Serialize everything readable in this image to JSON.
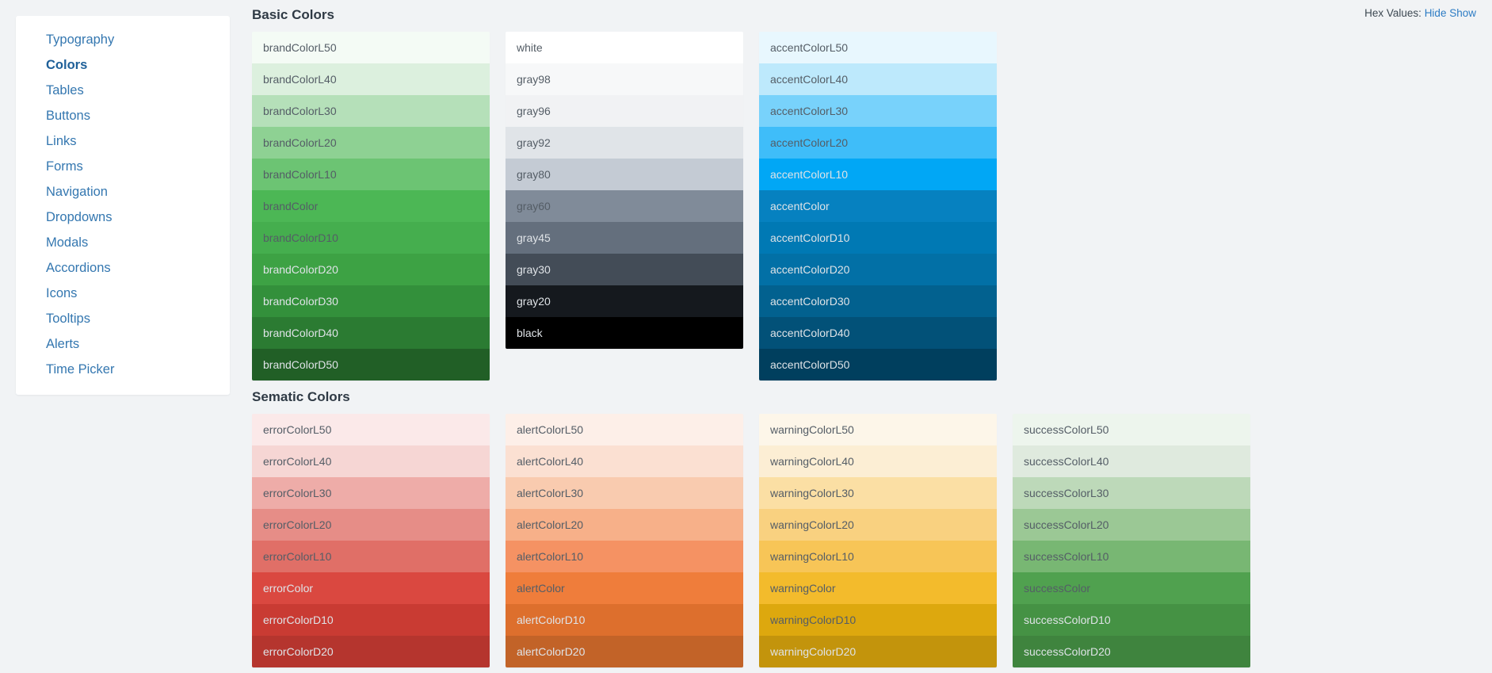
{
  "sidebar": {
    "items": [
      {
        "label": "Typography",
        "active": false
      },
      {
        "label": "Colors",
        "active": true
      },
      {
        "label": "Tables",
        "active": false
      },
      {
        "label": "Buttons",
        "active": false
      },
      {
        "label": "Links",
        "active": false
      },
      {
        "label": "Forms",
        "active": false
      },
      {
        "label": "Navigation",
        "active": false
      },
      {
        "label": "Dropdowns",
        "active": false
      },
      {
        "label": "Modals",
        "active": false
      },
      {
        "label": "Accordions",
        "active": false
      },
      {
        "label": "Icons",
        "active": false
      },
      {
        "label": "Tooltips",
        "active": false
      },
      {
        "label": "Alerts",
        "active": false
      },
      {
        "label": "Time Picker",
        "active": false
      }
    ]
  },
  "hex_toggle": {
    "label": "Hex Values:",
    "hide_label": "Hide",
    "show_label": "Show"
  },
  "sections": [
    {
      "title": "Basic Colors",
      "columns": [
        {
          "name": "brand",
          "swatches": [
            {
              "label": "brandColorL50",
              "hex": "#f4fbf5",
              "text": "dark"
            },
            {
              "label": "brandColorL40",
              "hex": "#dcf0de",
              "text": "dark"
            },
            {
              "label": "brandColorL30",
              "hex": "#b5e0b9",
              "text": "dark"
            },
            {
              "label": "brandColorL20",
              "hex": "#8ed193",
              "text": "dark"
            },
            {
              "label": "brandColorL10",
              "hex": "#6cc473",
              "text": "dark"
            },
            {
              "label": "brandColor",
              "hex": "#4cb755",
              "text": "dark"
            },
            {
              "label": "brandColorD10",
              "hex": "#45ae4e",
              "text": "dark"
            },
            {
              "label": "brandColorD20",
              "hex": "#3da244",
              "text": "light"
            },
            {
              "label": "brandColorD30",
              "hex": "#33903b",
              "text": "light"
            },
            {
              "label": "brandColorD40",
              "hex": "#2b7b32",
              "text": "light"
            },
            {
              "label": "brandColorD50",
              "hex": "#215f26",
              "text": "light"
            }
          ]
        },
        {
          "name": "gray",
          "swatches": [
            {
              "label": "white",
              "hex": "#ffffff",
              "text": "dark"
            },
            {
              "label": "gray98",
              "hex": "#f7f8f9",
              "text": "dark"
            },
            {
              "label": "gray96",
              "hex": "#f1f2f4",
              "text": "dark"
            },
            {
              "label": "gray92",
              "hex": "#e0e4e8",
              "text": "dark"
            },
            {
              "label": "gray80",
              "hex": "#c4cbd4",
              "text": "dark"
            },
            {
              "label": "gray60",
              "hex": "#808b99",
              "text": "dark"
            },
            {
              "label": "gray45",
              "hex": "#646f7d",
              "text": "light"
            },
            {
              "label": "gray30",
              "hex": "#434c57",
              "text": "light"
            },
            {
              "label": "gray20",
              "hex": "#15191e",
              "text": "light"
            },
            {
              "label": "black",
              "hex": "#000000",
              "text": "light"
            }
          ]
        },
        {
          "name": "accent",
          "swatches": [
            {
              "label": "accentColorL50",
              "hex": "#e8f7fe",
              "text": "dark"
            },
            {
              "label": "accentColorL40",
              "hex": "#bde9fc",
              "text": "dark"
            },
            {
              "label": "accentColorL30",
              "hex": "#78d2fb",
              "text": "dark"
            },
            {
              "label": "accentColorL20",
              "hex": "#3fbdf9",
              "text": "dark"
            },
            {
              "label": "accentColorL10",
              "hex": "#01a7f5",
              "text": "light"
            },
            {
              "label": "accentColor",
              "hex": "#0681c0",
              "text": "light"
            },
            {
              "label": "accentColorD10",
              "hex": "#0079b4",
              "text": "light"
            },
            {
              "label": "accentColorD20",
              "hex": "#0270a6",
              "text": "light"
            },
            {
              "label": "accentColorD30",
              "hex": "#02618f",
              "text": "light"
            },
            {
              "label": "accentColorD40",
              "hex": "#025178",
              "text": "light"
            },
            {
              "label": "accentColorD50",
              "hex": "#003f5e",
              "text": "light"
            }
          ]
        }
      ]
    },
    {
      "title": "Sematic Colors",
      "columns": [
        {
          "name": "error",
          "swatches": [
            {
              "label": "errorColorL50",
              "hex": "#fbe9e9",
              "text": "dark"
            },
            {
              "label": "errorColorL40",
              "hex": "#f6d6d4",
              "text": "dark"
            },
            {
              "label": "errorColorL30",
              "hex": "#eeaca8",
              "text": "dark"
            },
            {
              "label": "errorColorL20",
              "hex": "#e68d87",
              "text": "dark"
            },
            {
              "label": "errorColorL10",
              "hex": "#e06f67",
              "text": "dark"
            },
            {
              "label": "errorColor",
              "hex": "#da4840",
              "text": "light"
            },
            {
              "label": "errorColorD10",
              "hex": "#c93b33",
              "text": "light"
            },
            {
              "label": "errorColorD20",
              "hex": "#b5352e",
              "text": "light"
            }
          ]
        },
        {
          "name": "alert",
          "swatches": [
            {
              "label": "alertColorL50",
              "hex": "#fdefe8",
              "text": "dark"
            },
            {
              "label": "alertColorL40",
              "hex": "#fbe0d2",
              "text": "dark"
            },
            {
              "label": "alertColorL30",
              "hex": "#f9cbaf",
              "text": "dark"
            },
            {
              "label": "alertColorL20",
              "hex": "#f7b089",
              "text": "dark"
            },
            {
              "label": "alertColorL10",
              "hex": "#f59263",
              "text": "dark"
            },
            {
              "label": "alertColor",
              "hex": "#ef7d3b",
              "text": "dark"
            },
            {
              "label": "alertColorD10",
              "hex": "#dd6f2d",
              "text": "light"
            },
            {
              "label": "alertColorD20",
              "hex": "#c26328",
              "text": "light"
            }
          ]
        },
        {
          "name": "warning",
          "swatches": [
            {
              "label": "warningColorL50",
              "hex": "#fdf6e9",
              "text": "dark"
            },
            {
              "label": "warningColorL40",
              "hex": "#fceed4",
              "text": "dark"
            },
            {
              "label": "warningColorL30",
              "hex": "#fbdfa4",
              "text": "dark"
            },
            {
              "label": "warningColorL20",
              "hex": "#f9d180",
              "text": "dark"
            },
            {
              "label": "warningColorL10",
              "hex": "#f7c557",
              "text": "dark"
            },
            {
              "label": "warningColor",
              "hex": "#f3bb2c",
              "text": "dark"
            },
            {
              "label": "warningColorD10",
              "hex": "#dda80e",
              "text": "dark"
            },
            {
              "label": "warningColorD20",
              "hex": "#c3940c",
              "text": "light"
            }
          ]
        },
        {
          "name": "success",
          "swatches": [
            {
              "label": "successColorL50",
              "hex": "#edf5ed",
              "text": "dark"
            },
            {
              "label": "successColorL40",
              "hex": "#dfeade",
              "text": "dark"
            },
            {
              "label": "successColorL30",
              "hex": "#bdd9b9",
              "text": "dark"
            },
            {
              "label": "successColorL20",
              "hex": "#9bc895",
              "text": "dark"
            },
            {
              "label": "successColorL10",
              "hex": "#78b773",
              "text": "dark"
            },
            {
              "label": "successColor",
              "hex": "#50a14f",
              "text": "dark"
            },
            {
              "label": "successColorD10",
              "hex": "#459244",
              "text": "light"
            },
            {
              "label": "successColorD20",
              "hex": "#3f843e",
              "text": "light"
            }
          ]
        }
      ]
    }
  ]
}
